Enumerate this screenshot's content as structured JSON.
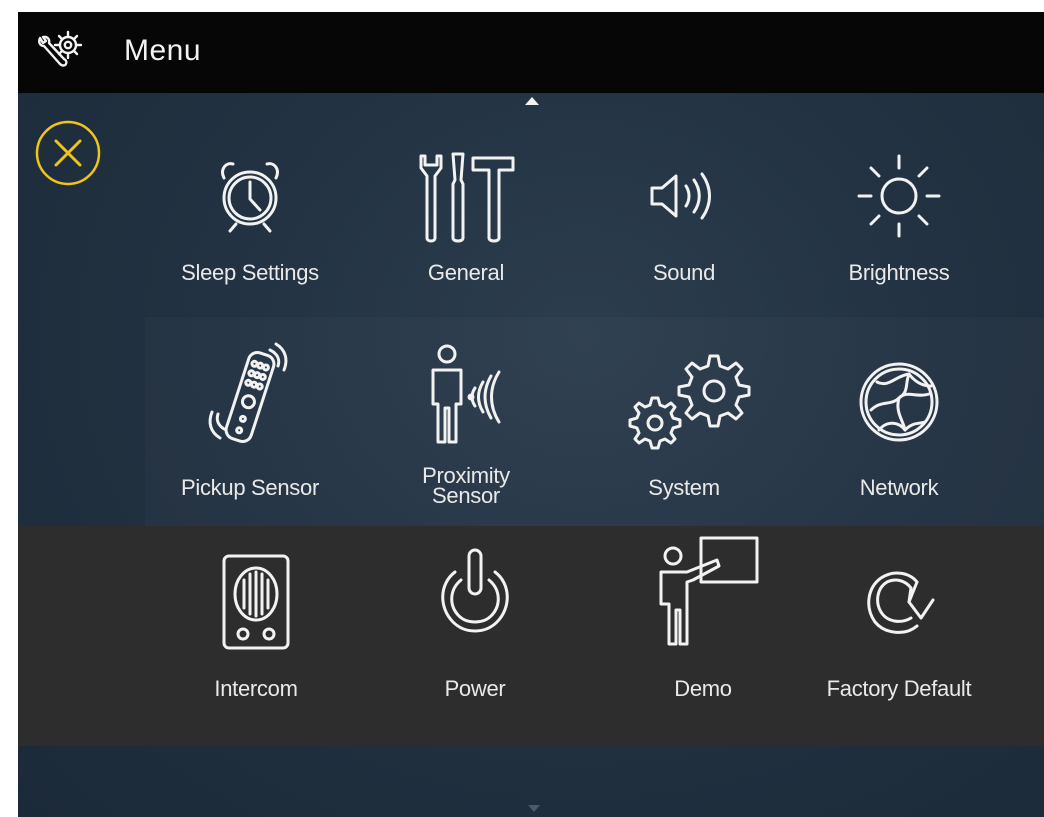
{
  "header": {
    "title": "Menu"
  },
  "colors": {
    "header_bg": "#060606",
    "accent_close": "#f0c419",
    "background": "#223242",
    "bottom_panel": "#2d2d2d",
    "icon_stroke": "#f2f2f2"
  },
  "menu": {
    "items": [
      {
        "label": "Sleep Settings",
        "icon": "alarm-clock-icon"
      },
      {
        "label": "General",
        "icon": "tools-icon"
      },
      {
        "label": "Sound",
        "icon": "speaker-icon"
      },
      {
        "label": "Brightness",
        "icon": "sun-icon"
      },
      {
        "label": "Pickup Sensor",
        "icon": "vibrating-remote-icon"
      },
      {
        "label_line1": "Proximity",
        "label_line2": "Sensor",
        "icon": "person-proximity-icon"
      },
      {
        "label": "System",
        "icon": "gears-icon"
      },
      {
        "label": "Network",
        "icon": "globe-network-icon"
      },
      {
        "label": "Intercom",
        "icon": "intercom-speaker-icon"
      },
      {
        "label": "Power",
        "icon": "power-icon"
      },
      {
        "label": "Demo",
        "icon": "presenter-board-icon"
      },
      {
        "label": "Factory Default",
        "icon": "reset-arrow-icon"
      }
    ]
  }
}
